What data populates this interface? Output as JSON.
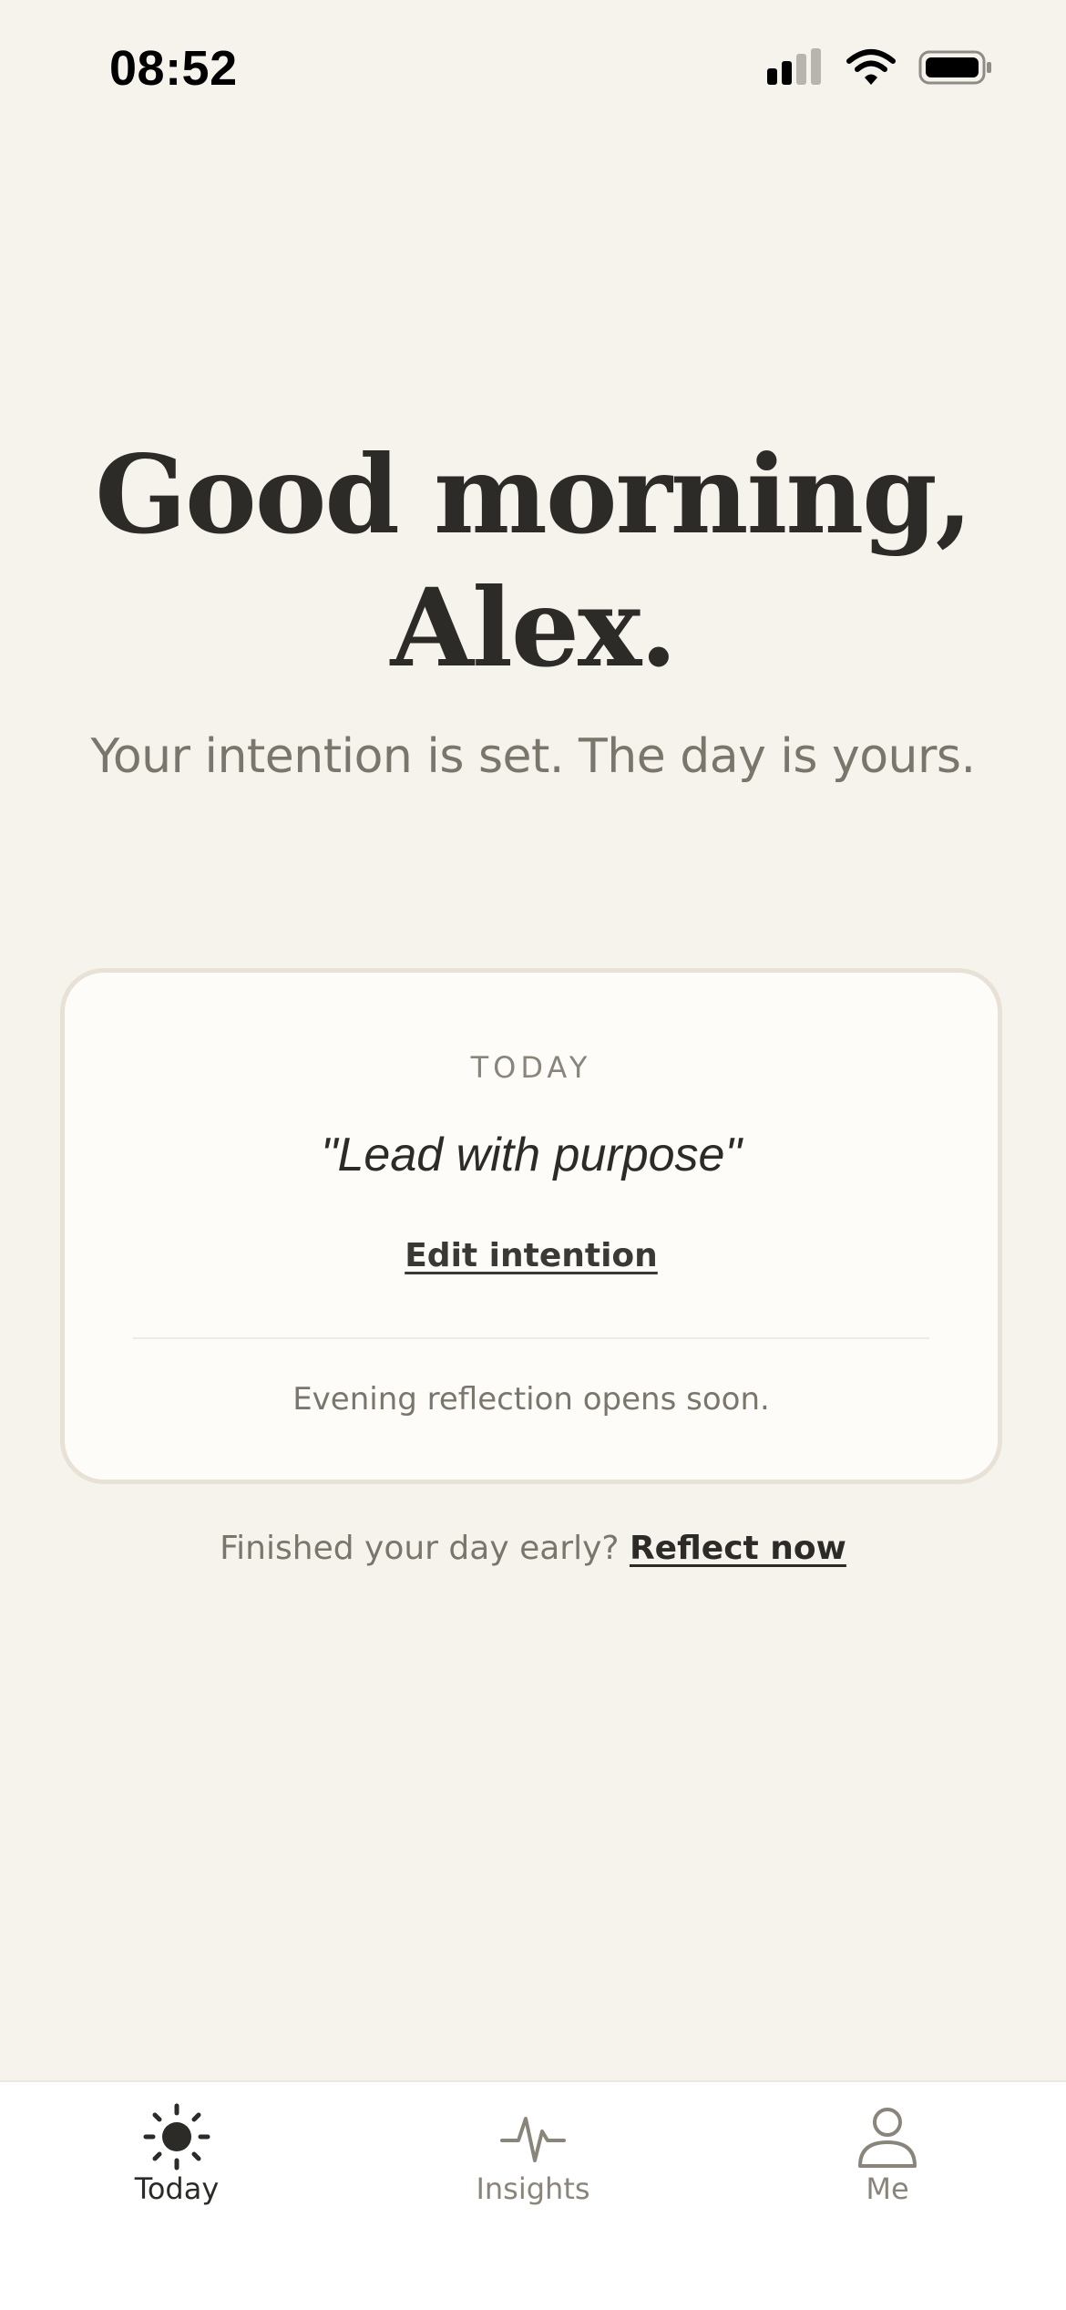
{
  "status_bar": {
    "time": "08:52"
  },
  "greeting": {
    "line1": "Good morning,",
    "line2": "Alex."
  },
  "subtitle": "Your intention is set. The day is yours.",
  "card": {
    "label": "TODAY",
    "quote": "\"Lead with purpose\"",
    "edit_label": "Edit intention",
    "note": "Evening reflection opens soon."
  },
  "early": {
    "prompt": "Finished your day early?",
    "link": "Reflect now"
  },
  "tabs": [
    {
      "label": "Today",
      "icon": "sun-icon",
      "active": true
    },
    {
      "label": "Insights",
      "icon": "pulse-icon",
      "active": false
    },
    {
      "label": "Me",
      "icon": "person-icon",
      "active": false
    }
  ],
  "colors": {
    "background": "#f6f3ed",
    "text": "#2c2b27",
    "muted": "#7b766c",
    "card": "#fdfcf8"
  }
}
